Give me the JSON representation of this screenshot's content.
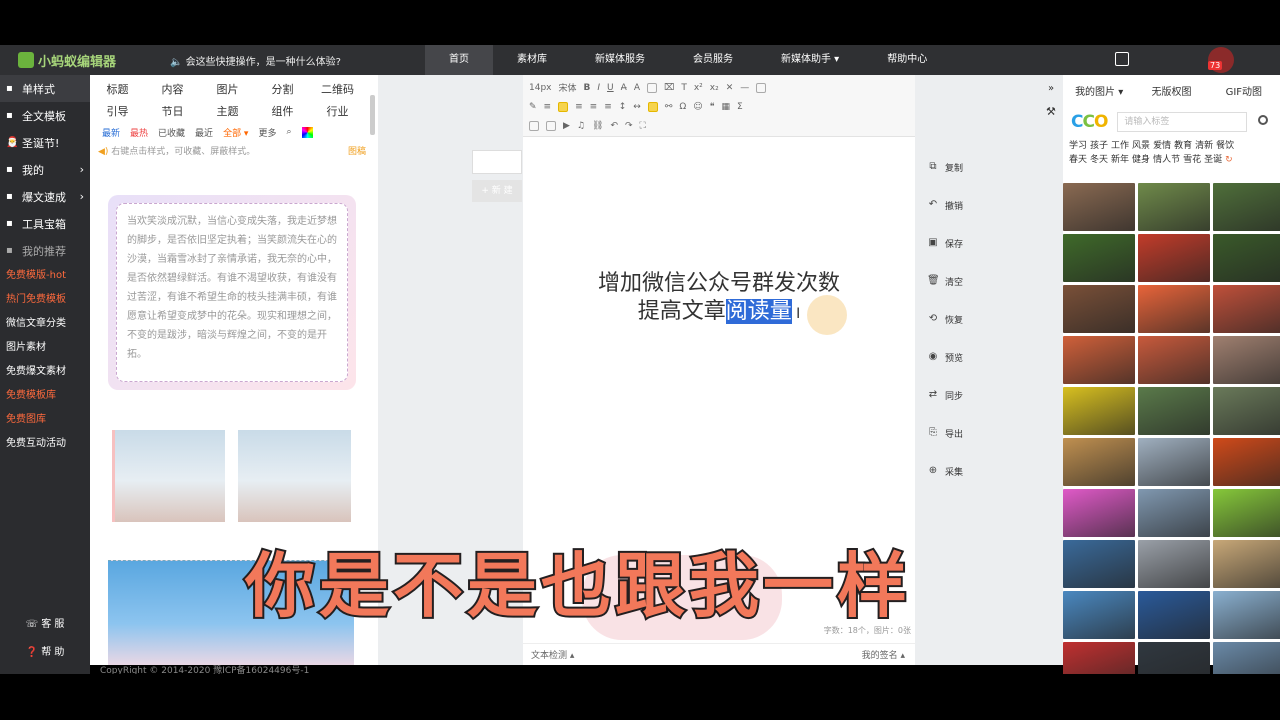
{
  "app": {
    "title": "小蚂蚁编辑器"
  },
  "topbar": {
    "notice": "会这些快捷操作，是一种什么体验?",
    "nav": [
      "首页",
      "素材库",
      "新媒体服务",
      "会员服务",
      "新媒体助手 ▾",
      "帮助中心"
    ],
    "badge": "73"
  },
  "leftnav": {
    "main": [
      {
        "icon": "grid-icon",
        "label": "单样式",
        "arrow": ""
      },
      {
        "icon": "document-icon",
        "label": "全文模板",
        "arrow": ""
      },
      {
        "icon": "santa-hat-icon",
        "label": "圣诞节!",
        "arrow": ""
      },
      {
        "icon": "user-icon",
        "label": "我的",
        "arrow": "›"
      },
      {
        "icon": "lightning-icon",
        "label": "爆文速成",
        "arrow": "›"
      },
      {
        "icon": "toolbox-icon",
        "label": "工具宝箱",
        "arrow": ""
      },
      {
        "icon": "eye-icon",
        "label": "我的推荐",
        "arrow": ""
      }
    ],
    "links": [
      {
        "label": "免费模版-hot",
        "red": true
      },
      {
        "label": "热门免费模板",
        "red": true
      },
      {
        "label": "微信文章分类",
        "red": false
      },
      {
        "label": "图片素材",
        "red": false
      },
      {
        "label": "免费爆文素材",
        "red": false
      },
      {
        "label": "免费模板库",
        "red": true
      },
      {
        "label": "免费图库",
        "red": true
      },
      {
        "label": "免费互动活动",
        "red": false
      }
    ],
    "service": "客 服",
    "help": "帮 助"
  },
  "panel": {
    "tabs1": [
      "标题",
      "内容",
      "图片",
      "分割",
      "二维码"
    ],
    "tabs2": [
      "引导",
      "节日",
      "主题",
      "组件",
      "行业"
    ],
    "filters": [
      "最新",
      "最热",
      "已收藏",
      "最近",
      "全部 ▾",
      "更多"
    ],
    "hint": "右键点击样式，可收藏、屏蔽样式。",
    "hint_right": "图稿",
    "card_text": "当欢笑淡成沉默，当信心变成失落，我走近梦想的脚步，是否依旧坚定执着；当笑颜流失在心的沙漠，当霜雪冰封了亲情承诺，我无奈的心中，是否依然碧绿鲜活。有谁不渴望收获，有谁没有过苦涩，有谁不希望生命的枝头挂满丰硕，有谁愿意让希望变成梦中的花朵。现实和理想之间，不变的是跋涉，暗淡与辉煌之间，不变的是开拓。",
    "copyright": "CopyRight © 2014-2020 豫ICP备16024496号-1"
  },
  "editor": {
    "font_size": "14px",
    "font_name": "宋体",
    "line1": "增加微信公众号群发次数",
    "line2_plain": "提高文章",
    "line2_selected": "阅读量",
    "stats": "字数：18个，图片：0张",
    "footer_left": "文本检测 ▴",
    "footer_right": "我的签名 ▴",
    "side_new": "+ 新 建"
  },
  "actions": [
    {
      "icon": "copy-icon",
      "glyph": "⧉",
      "label": "复制"
    },
    {
      "icon": "undo-icon",
      "glyph": "↶",
      "label": "撤销"
    },
    {
      "icon": "save-icon",
      "glyph": "▣",
      "label": "保存"
    },
    {
      "icon": "trash-icon",
      "glyph": "🗑",
      "label": "清空"
    },
    {
      "icon": "restore-icon",
      "glyph": "⟲",
      "label": "恢复"
    },
    {
      "icon": "eye-icon",
      "glyph": "◉",
      "label": "预览"
    },
    {
      "icon": "sync-icon",
      "glyph": "⇄",
      "label": "同步"
    },
    {
      "icon": "export-icon",
      "glyph": "⎘",
      "label": "导出"
    },
    {
      "icon": "collect-icon",
      "glyph": "⊕",
      "label": "采集"
    }
  ],
  "rightpanel": {
    "tabs": [
      "我的图片 ▾",
      "无版权图",
      "GIF动图"
    ],
    "search_placeholder": "请输入标签",
    "tags_row1": [
      "学习",
      "孩子",
      "工作",
      "风景",
      "爱情",
      "教育",
      "清新",
      "餐饮"
    ],
    "tags_row2": [
      "春天",
      "冬天",
      "新年",
      "健身",
      "情人节",
      "雪花",
      "圣诞"
    ],
    "thumb_colors": [
      "#8a6a52",
      "#6f8a4a",
      "#4f6f3a",
      "#3f6a2a",
      "#c23c2a",
      "#3a5a2a",
      "#7a5038",
      "#e8643a",
      "#c0503a",
      "#d0603a",
      "#c85a3c",
      "#a08070",
      "#d8c020",
      "#5a7a4a",
      "#6a7a5a",
      "#c09050",
      "#a0b0c0",
      "#d04a1a",
      "#e05ac8",
      "#8098b0",
      "#86c83a",
      "#3a6a9a",
      "#9aa0a8",
      "#c8a878",
      "#4a88c0",
      "#2a5a9a",
      "#8ab0d0",
      "#c03030",
      "#303840",
      "#6a8aa8"
    ]
  },
  "caption": "你是不是也跟我一样"
}
